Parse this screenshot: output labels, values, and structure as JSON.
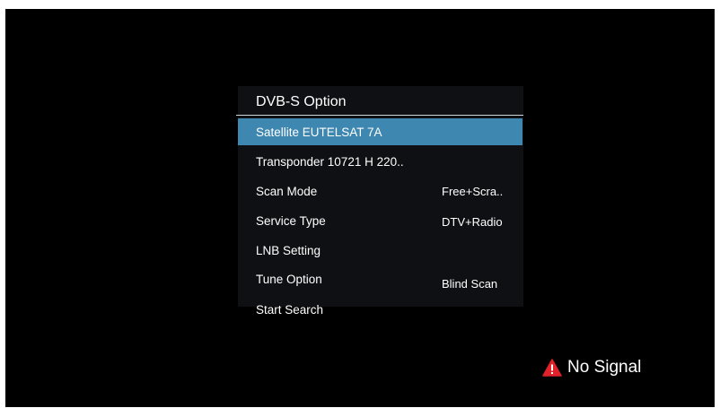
{
  "menu": {
    "title": "DVB-S Option",
    "items": [
      {
        "label": "Satellite EUTELSAT 7A",
        "value": ""
      },
      {
        "label": "Transponder 10721 H 220..",
        "value": ""
      },
      {
        "label": "Scan Mode",
        "value": "Free+Scra.."
      },
      {
        "label": "Service Type",
        "value": "DTV+Radio"
      },
      {
        "label": "LNB Setting",
        "value": ""
      },
      {
        "label": "Tune Option",
        "value": "Blind Scan"
      },
      {
        "label": "Start Search",
        "value": ""
      }
    ],
    "selected_index": 0
  },
  "status": {
    "text": "No Signal",
    "icon": "warning-icon",
    "icon_color": "#e0222a"
  },
  "colors": {
    "highlight": "#3d87b0",
    "panel": "#0e1013",
    "background": "#000000"
  }
}
